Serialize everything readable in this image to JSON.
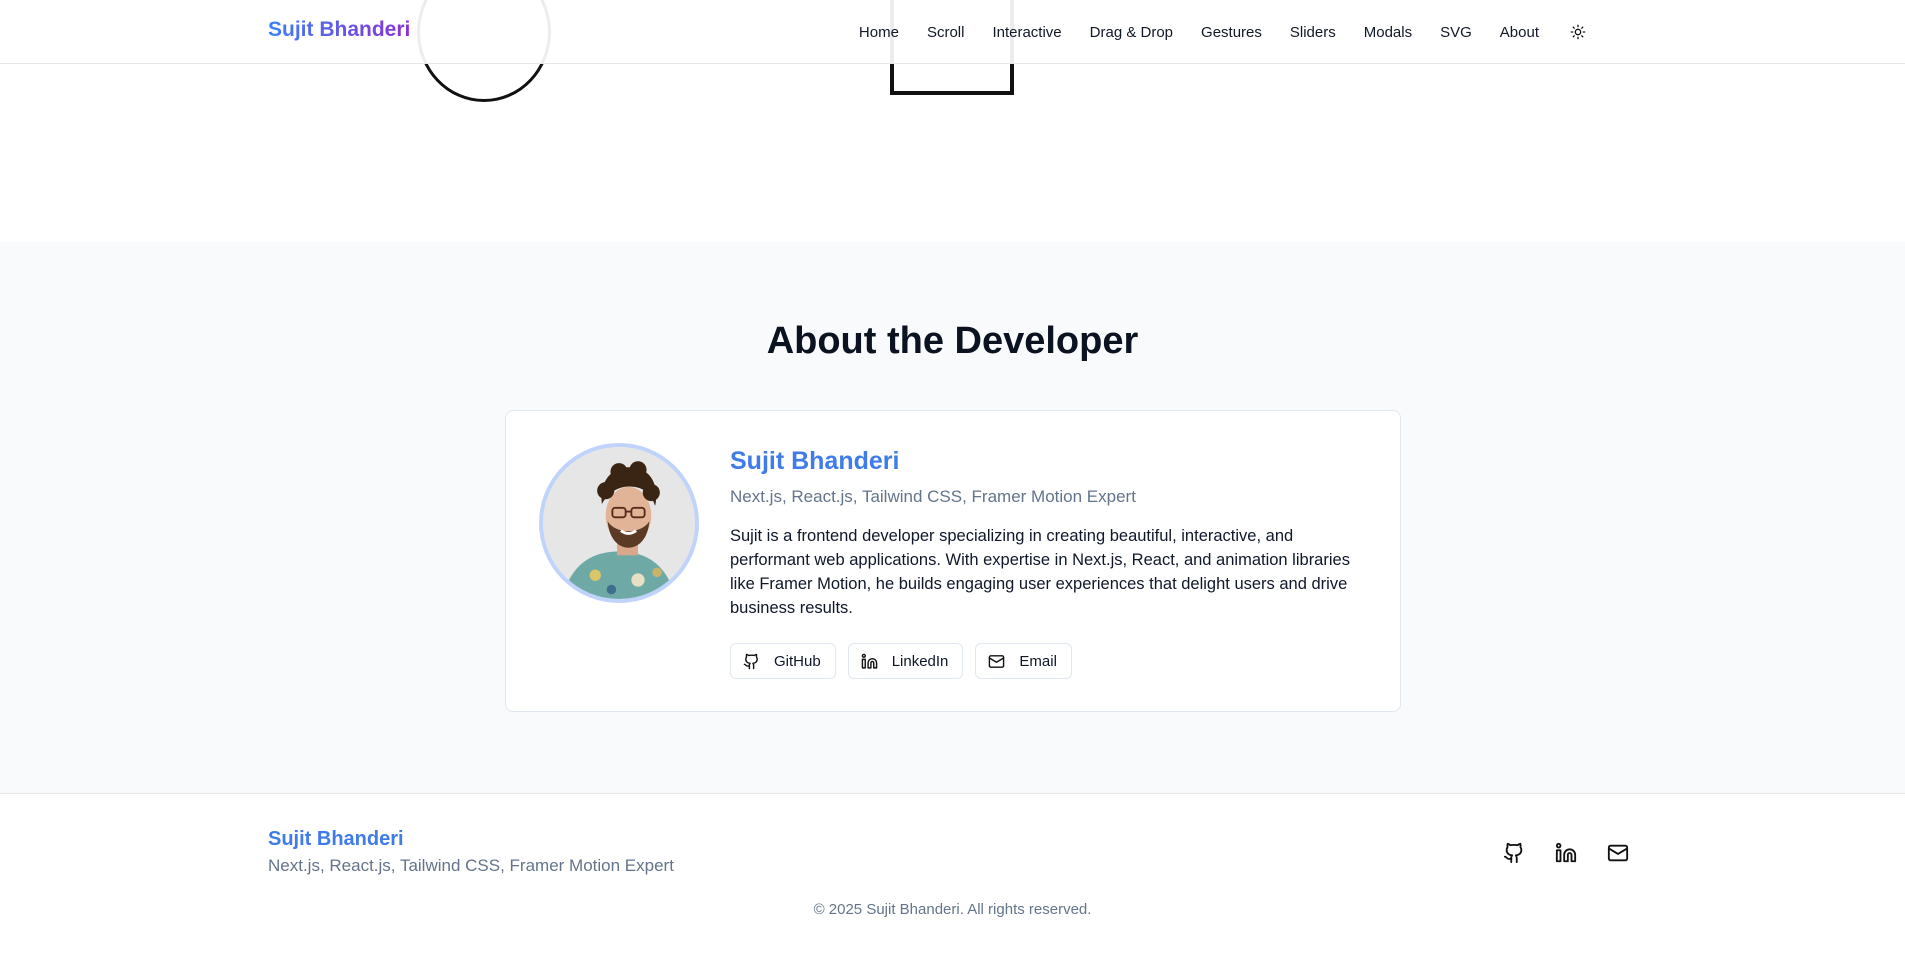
{
  "header": {
    "brand": "Sujit Bhanderi",
    "nav": [
      "Home",
      "Scroll",
      "Interactive",
      "Drag & Drop",
      "Gestures",
      "Sliders",
      "Modals",
      "SVG",
      "About"
    ],
    "theme_icon": "sun-icon"
  },
  "about": {
    "title": "About the Developer",
    "name": "Sujit Bhanderi",
    "subtitle": "Next.js, React.js, Tailwind CSS, Framer Motion Expert",
    "bio": "Sujit is a frontend developer specializing in creating beautiful, interactive, and performant web applications. With expertise in Next.js, React, and animation libraries like Framer Motion, he builds engaging user experiences that delight users and drive business results.",
    "links": [
      {
        "label": "GitHub",
        "icon": "github-icon"
      },
      {
        "label": "LinkedIn",
        "icon": "linkedin-icon"
      },
      {
        "label": "Email",
        "icon": "mail-icon"
      }
    ]
  },
  "footer": {
    "name": "Sujit Bhanderi",
    "subtitle": "Next.js, React.js, Tailwind CSS, Framer Motion Expert",
    "copyright": "© 2025 Sujit Bhanderi. All rights reserved."
  },
  "colors": {
    "accent": "#3f7be9",
    "brand_gradient_start": "#3b82f6",
    "brand_gradient_end": "#8b2fd6",
    "muted": "#64748b",
    "section_bg": "#f9fafb"
  }
}
